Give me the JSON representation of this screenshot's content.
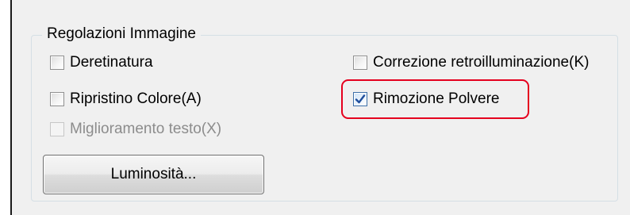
{
  "group": {
    "title": "Regolazioni Immagine"
  },
  "options": {
    "deretinatura": {
      "label": "Deretinatura",
      "checked": false,
      "enabled": true
    },
    "correzione": {
      "label": "Correzione retroilluminazione(K)",
      "checked": false,
      "enabled": true
    },
    "ripristino": {
      "label": "Ripristino Colore(A)",
      "checked": false,
      "enabled": true
    },
    "rimozione": {
      "label": "Rimozione Polvere",
      "checked": true,
      "enabled": true
    },
    "miglioramento": {
      "label": "Miglioramento testo(X)",
      "checked": false,
      "enabled": false
    }
  },
  "buttons": {
    "luminosita": "Luminosità..."
  },
  "colors": {
    "highlight": "#e5001e",
    "panel": "#f0f0f0",
    "checkmark": "#1f4e9c"
  },
  "icons": {
    "checkmark": "checkmark-icon"
  }
}
